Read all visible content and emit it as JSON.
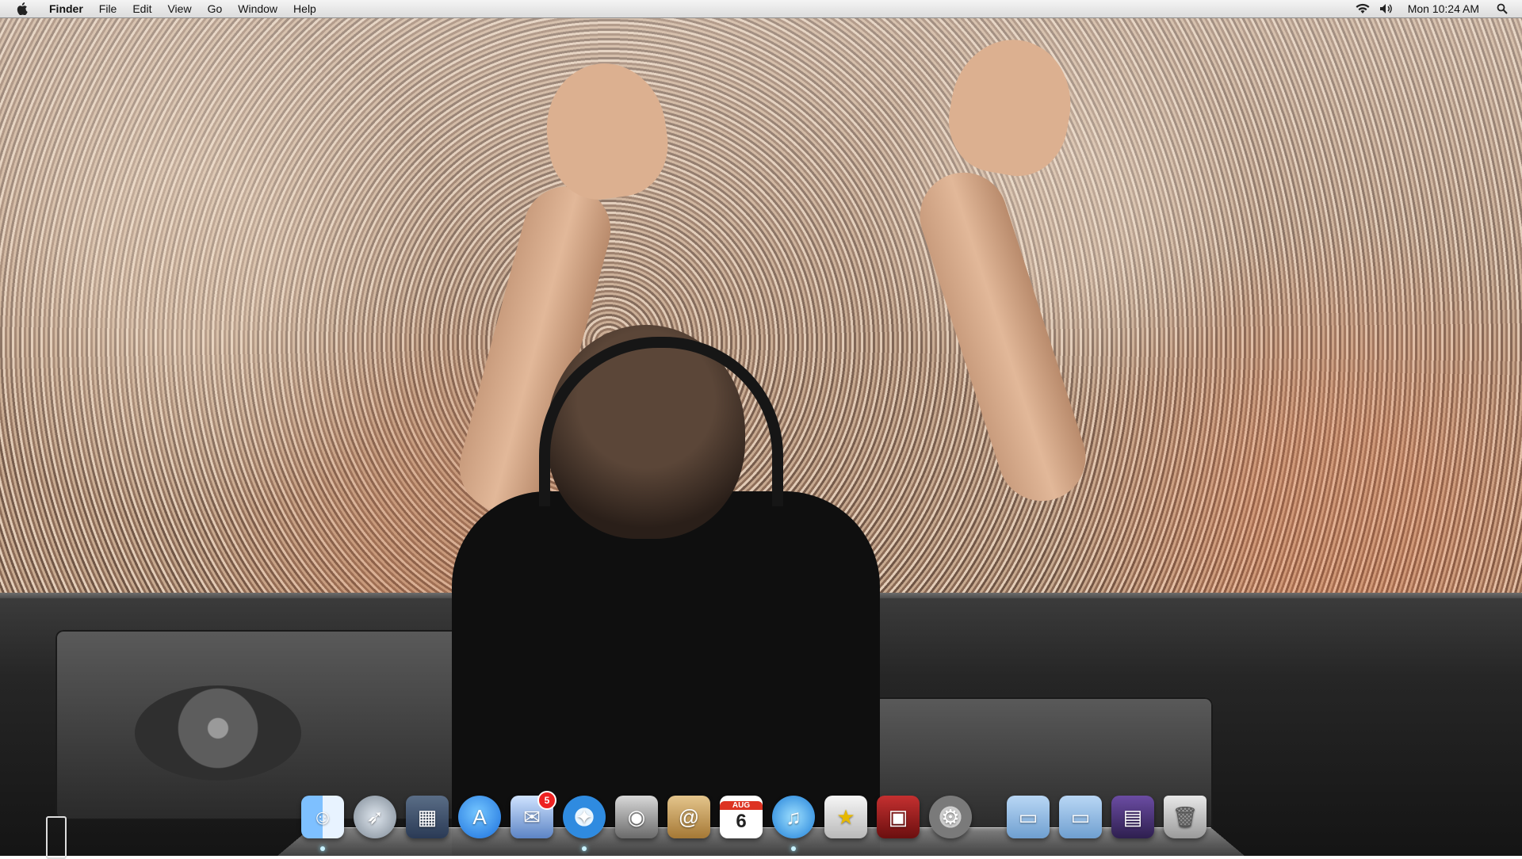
{
  "menubar": {
    "apple_icon": "apple-icon",
    "items": [
      "Finder",
      "File",
      "Edit",
      "View",
      "Go",
      "Window",
      "Help"
    ],
    "status": {
      "wifi_icon": "wifi-icon",
      "volume_icon": "volume-icon",
      "clock": "Mon 10:24 AM",
      "spotlight_icon": "search-icon"
    }
  },
  "desktop": {
    "wallpaper": "concert crowd DJ photo"
  },
  "dock": {
    "items": [
      {
        "name": "finder",
        "icon": "finder-icon"
      },
      {
        "name": "launchpad",
        "icon": "rocket-icon"
      },
      {
        "name": "photo-browser",
        "icon": "photos-icon"
      },
      {
        "name": "app-store",
        "icon": "app-store-icon"
      },
      {
        "name": "mail",
        "icon": "mail-icon",
        "badge": "5"
      },
      {
        "name": "safari",
        "icon": "compass-icon"
      },
      {
        "name": "facetime",
        "icon": "camera-icon"
      },
      {
        "name": "address-book",
        "icon": "contacts-icon"
      },
      {
        "name": "ical",
        "icon": "calendar-icon",
        "month": "AUG",
        "day": "6"
      },
      {
        "name": "itunes",
        "icon": "music-note-icon"
      },
      {
        "name": "imovie",
        "icon": "star-clapper-icon"
      },
      {
        "name": "photo-booth",
        "icon": "photo-booth-icon"
      },
      {
        "name": "system-preferences",
        "icon": "gear-icon"
      },
      {
        "name": "applications-folder",
        "icon": "folder-icon"
      },
      {
        "name": "documents-folder",
        "icon": "folder-icon"
      },
      {
        "name": "photos-stack",
        "icon": "image-stack-icon"
      },
      {
        "name": "trash",
        "icon": "trash-icon"
      }
    ]
  }
}
